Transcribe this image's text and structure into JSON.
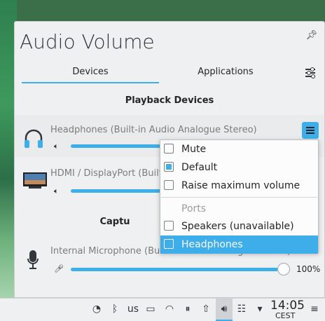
{
  "panel": {
    "title": "Audio Volume",
    "tabs": [
      {
        "label": "Devices"
      },
      {
        "label": "Applications"
      }
    ],
    "playback": {
      "section_title": "Playback Devices",
      "devices": [
        {
          "name": "Headphones (Built-in Audio Analogue Stereo)",
          "volume_fraction": 1.0
        },
        {
          "name": "HDMI / DisplayPort (Built-",
          "volume_fraction": 1.0
        }
      ]
    },
    "capture": {
      "section_title": "Captu",
      "devices": [
        {
          "name": "Internal Microphone (Built-in Audio Analogue Stereo)",
          "volume_pct": "100%",
          "volume_fraction": 1.0
        }
      ]
    }
  },
  "context_menu": {
    "items": [
      {
        "label": "Mute",
        "checked": false
      },
      {
        "label": "Default",
        "checked": true
      },
      {
        "label": "Raise maximum volume",
        "checked": false
      }
    ],
    "ports_header": "Ports",
    "ports": [
      {
        "label": "Speakers (unavailable)",
        "checked": false
      },
      {
        "label": "Headphones",
        "checked": true
      }
    ]
  },
  "taskbar": {
    "keyboard_layout": "us",
    "clock": {
      "time": "14:05",
      "timezone": "CEST"
    }
  },
  "colors": {
    "accent": "#3daee9",
    "panel_bg": "#eff0f1"
  }
}
